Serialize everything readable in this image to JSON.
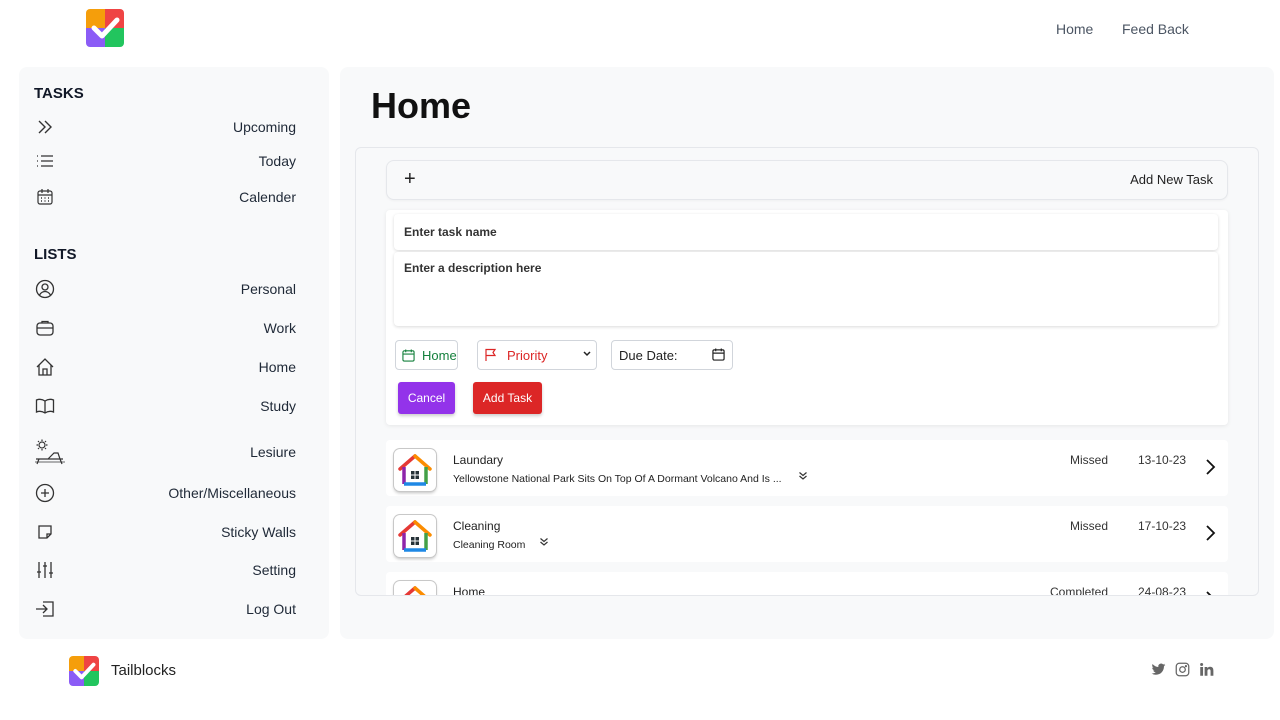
{
  "header": {
    "nav": [
      "Home",
      "Feed Back"
    ]
  },
  "sidebar": {
    "tasks_heading": "TASKS",
    "tasks": [
      {
        "label": "Upcoming",
        "icon": "double-chevron-right-icon"
      },
      {
        "label": "Today",
        "icon": "list-icon"
      },
      {
        "label": "Calender",
        "icon": "calendar-icon"
      }
    ],
    "lists_heading": "LISTS",
    "lists": [
      {
        "label": "Personal",
        "icon": "user-circle-icon"
      },
      {
        "label": "Work",
        "icon": "briefcase-icon"
      },
      {
        "label": "Home",
        "icon": "house-icon"
      },
      {
        "label": "Study",
        "icon": "book-icon"
      },
      {
        "label": "Lesiure",
        "icon": "sunbed-icon"
      },
      {
        "label": "Other/Miscellaneous",
        "icon": "plus-circle-icon"
      },
      {
        "label": "Sticky Walls",
        "icon": "sticky-note-icon"
      },
      {
        "label": "Setting",
        "icon": "sliders-icon"
      },
      {
        "label": "Log Out",
        "icon": "logout-icon"
      }
    ]
  },
  "main": {
    "title": "Home",
    "add_task_label": "Add New Task",
    "form": {
      "name_placeholder": "Enter task name",
      "desc_placeholder": "Enter a description here",
      "list_chip": "Home",
      "priority_label": "Priority",
      "due_date_label": "Due Date:",
      "cancel_label": "Cancel",
      "add_label": "Add Task"
    },
    "tasks": [
      {
        "title": "Laundary",
        "desc": "Yellowstone National Park Sits On Top Of A Dormant Volcano And Is ...",
        "status": "Missed",
        "date": "13-10-23"
      },
      {
        "title": "Cleaning",
        "desc": "Cleaning Room",
        "status": "Missed",
        "date": "17-10-23"
      },
      {
        "title": "Home",
        "desc": "",
        "status": "Completed",
        "date": "24-08-23"
      }
    ]
  },
  "footer": {
    "brand": "Tailblocks",
    "social": [
      "twitter-icon",
      "instagram-icon",
      "linkedin-icon"
    ]
  },
  "colors": {
    "cancel": "#9333ea",
    "add": "#dc2626",
    "chip_home": "#15803d",
    "priority": "#dc2626"
  }
}
